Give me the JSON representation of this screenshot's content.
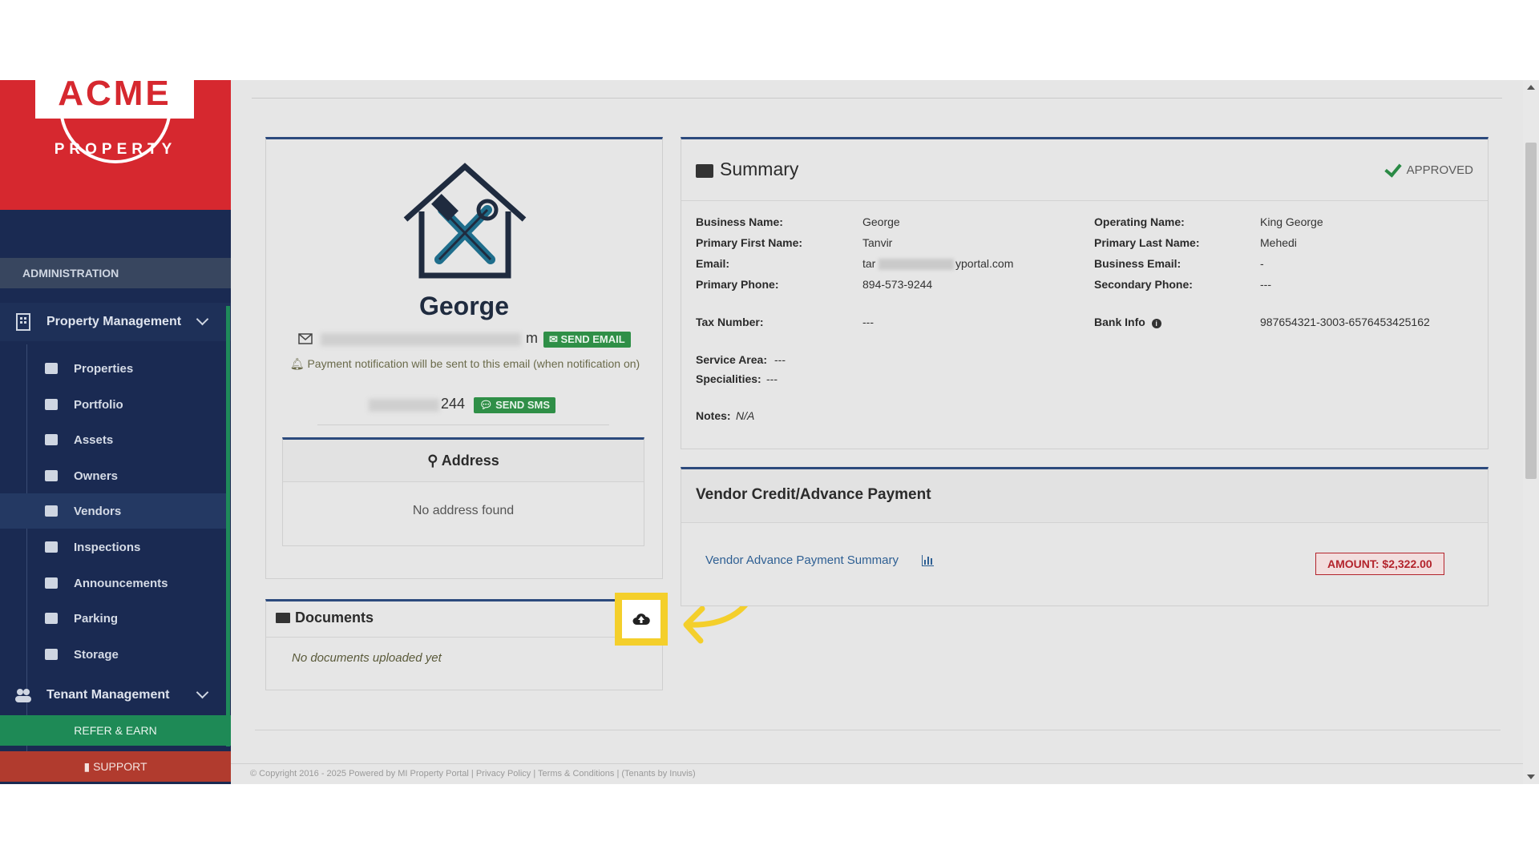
{
  "brand": {
    "name": "ACME",
    "subtitle": "PROPERTY"
  },
  "sidebar": {
    "admin_label": "ADMINISTRATION",
    "property_management": {
      "label": "Property Management",
      "items": [
        {
          "label": "Properties",
          "icon": "home-icon"
        },
        {
          "label": "Portfolio",
          "icon": "building-icon"
        },
        {
          "label": "Assets",
          "icon": "box-icon"
        },
        {
          "label": "Owners",
          "icon": "user-icon"
        },
        {
          "label": "Vendors",
          "icon": "briefcase-icon",
          "active": true
        },
        {
          "label": "Inspections",
          "icon": "search-icon"
        },
        {
          "label": "Announcements",
          "icon": "megaphone-icon"
        },
        {
          "label": "Parking",
          "icon": "car-icon"
        },
        {
          "label": "Storage",
          "icon": "basket-icon"
        }
      ]
    },
    "tenant_management": {
      "label": "Tenant Management"
    },
    "refer_label": "REFER & EARN",
    "support_label": "SUPPORT"
  },
  "profile": {
    "name": "George",
    "email_tail": "m",
    "send_email_label": "SEND EMAIL",
    "notification_note": "Payment notification will be sent to this email (when notification on)",
    "phone_tail": "244",
    "send_sms_label": "SEND SMS",
    "address_title": "Address",
    "address_empty": "No address found"
  },
  "documents": {
    "title": "Documents",
    "empty": "No documents uploaded yet"
  },
  "summary": {
    "title": "Summary",
    "status": "APPROVED",
    "fields": {
      "business_name_label": "Business Name:",
      "business_name": "George",
      "primary_first_name_label": "Primary First Name:",
      "primary_first_name": "Tanvir",
      "email_label": "Email:",
      "email_start": "tar",
      "email_end": "yportal.com",
      "primary_phone_label": "Primary Phone:",
      "primary_phone": "894-573-9244",
      "tax_number_label": "Tax Number:",
      "tax_number": "---",
      "service_area_label": "Service Area:",
      "service_area": "---",
      "specialities_label": "Specialities:",
      "specialities": "---",
      "notes_label": "Notes:",
      "notes": "N/A",
      "operating_name_label": "Operating Name:",
      "operating_name": "King George",
      "primary_last_name_label": "Primary Last Name:",
      "primary_last_name": "Mehedi",
      "business_email_label": "Business Email:",
      "business_email": "-",
      "secondary_phone_label": "Secondary Phone:",
      "secondary_phone": "---",
      "bank_info_label": "Bank Info",
      "bank_info": "987654321-3003-6576453425162"
    }
  },
  "credit": {
    "title": "Vendor Credit/Advance Payment",
    "link": "Vendor Advance Payment Summary",
    "amount": "AMOUNT: $2,322.00"
  },
  "footer": {
    "text": "© Copyright 2016 - 2025 Powered by MI Property Portal | Privacy Policy | Terms & Conditions | (Tenants by Inuvis)"
  },
  "colors": {
    "sidebar_bg": "#1a2a52",
    "brand_red": "#d6282f",
    "panel_accent": "#2c4a7d",
    "green_button": "#2f8f47",
    "highlight": "#f4cf2b"
  }
}
